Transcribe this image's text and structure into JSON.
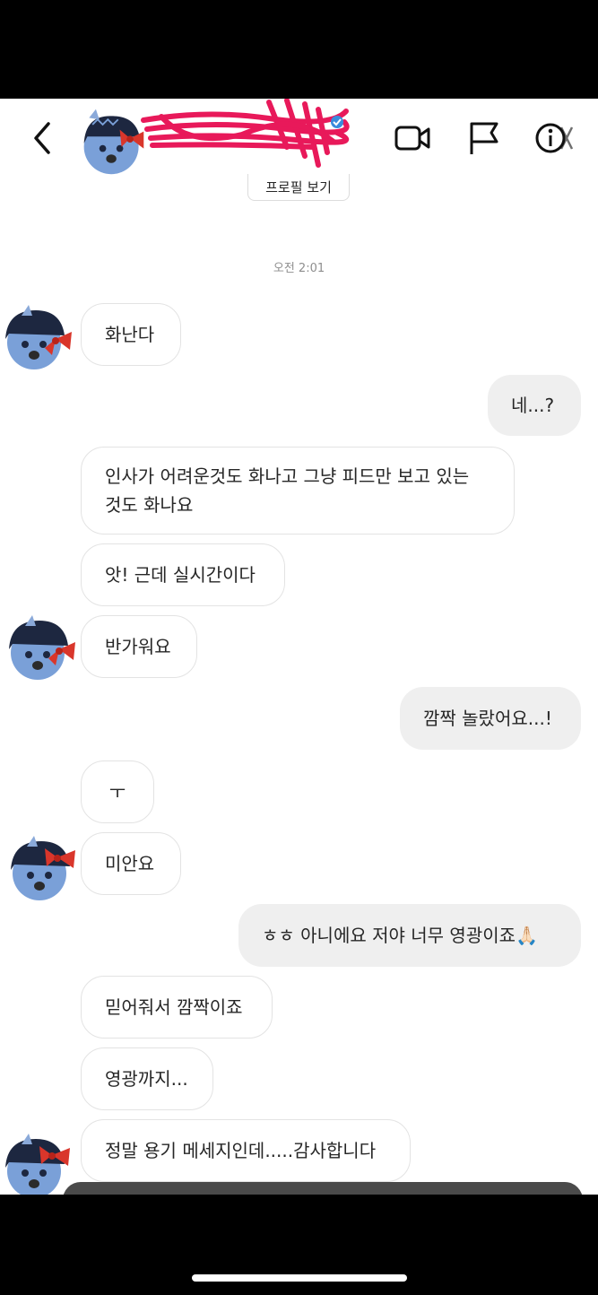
{
  "header": {
    "back": "back-icon",
    "video": "video-call-icon",
    "report": "flag-icon",
    "info": "info-icon",
    "profile_button": "프로필 보기"
  },
  "thread": {
    "timestamp": "오전 2:01",
    "messages": [
      {
        "dir": "in",
        "text": "화난다"
      },
      {
        "dir": "out",
        "text": "네...?"
      },
      {
        "dir": "in",
        "text": "인사가 어려운것도 화나고 그냥 피드만 보고 있는 것도 화나요"
      },
      {
        "dir": "in",
        "text": "앗! 근데 실시간이다"
      },
      {
        "dir": "in",
        "text": "반가워요"
      },
      {
        "dir": "out",
        "text": "깜짝 놀랐어요...!"
      },
      {
        "dir": "in",
        "text": "ㅜ"
      },
      {
        "dir": "in",
        "text": "미안요"
      },
      {
        "dir": "out",
        "text": "ㅎㅎ 아니에요 저야 너무 영광이죠🙏🏻"
      },
      {
        "dir": "in",
        "text": "믿어줘서 깜짝이죠"
      },
      {
        "dir": "in",
        "text": "영광까지..."
      },
      {
        "dir": "in",
        "text": "정말 용기 메세지인데.....감사합니다"
      }
    ]
  },
  "colors": {
    "incoming_border": "#e3e3e3",
    "outgoing_bg": "#efefef",
    "avatar_face": "#7aa0d8",
    "avatar_hat": "#1d2740",
    "avatar_bow": "#d9362b",
    "scribble": "#e8195a"
  }
}
